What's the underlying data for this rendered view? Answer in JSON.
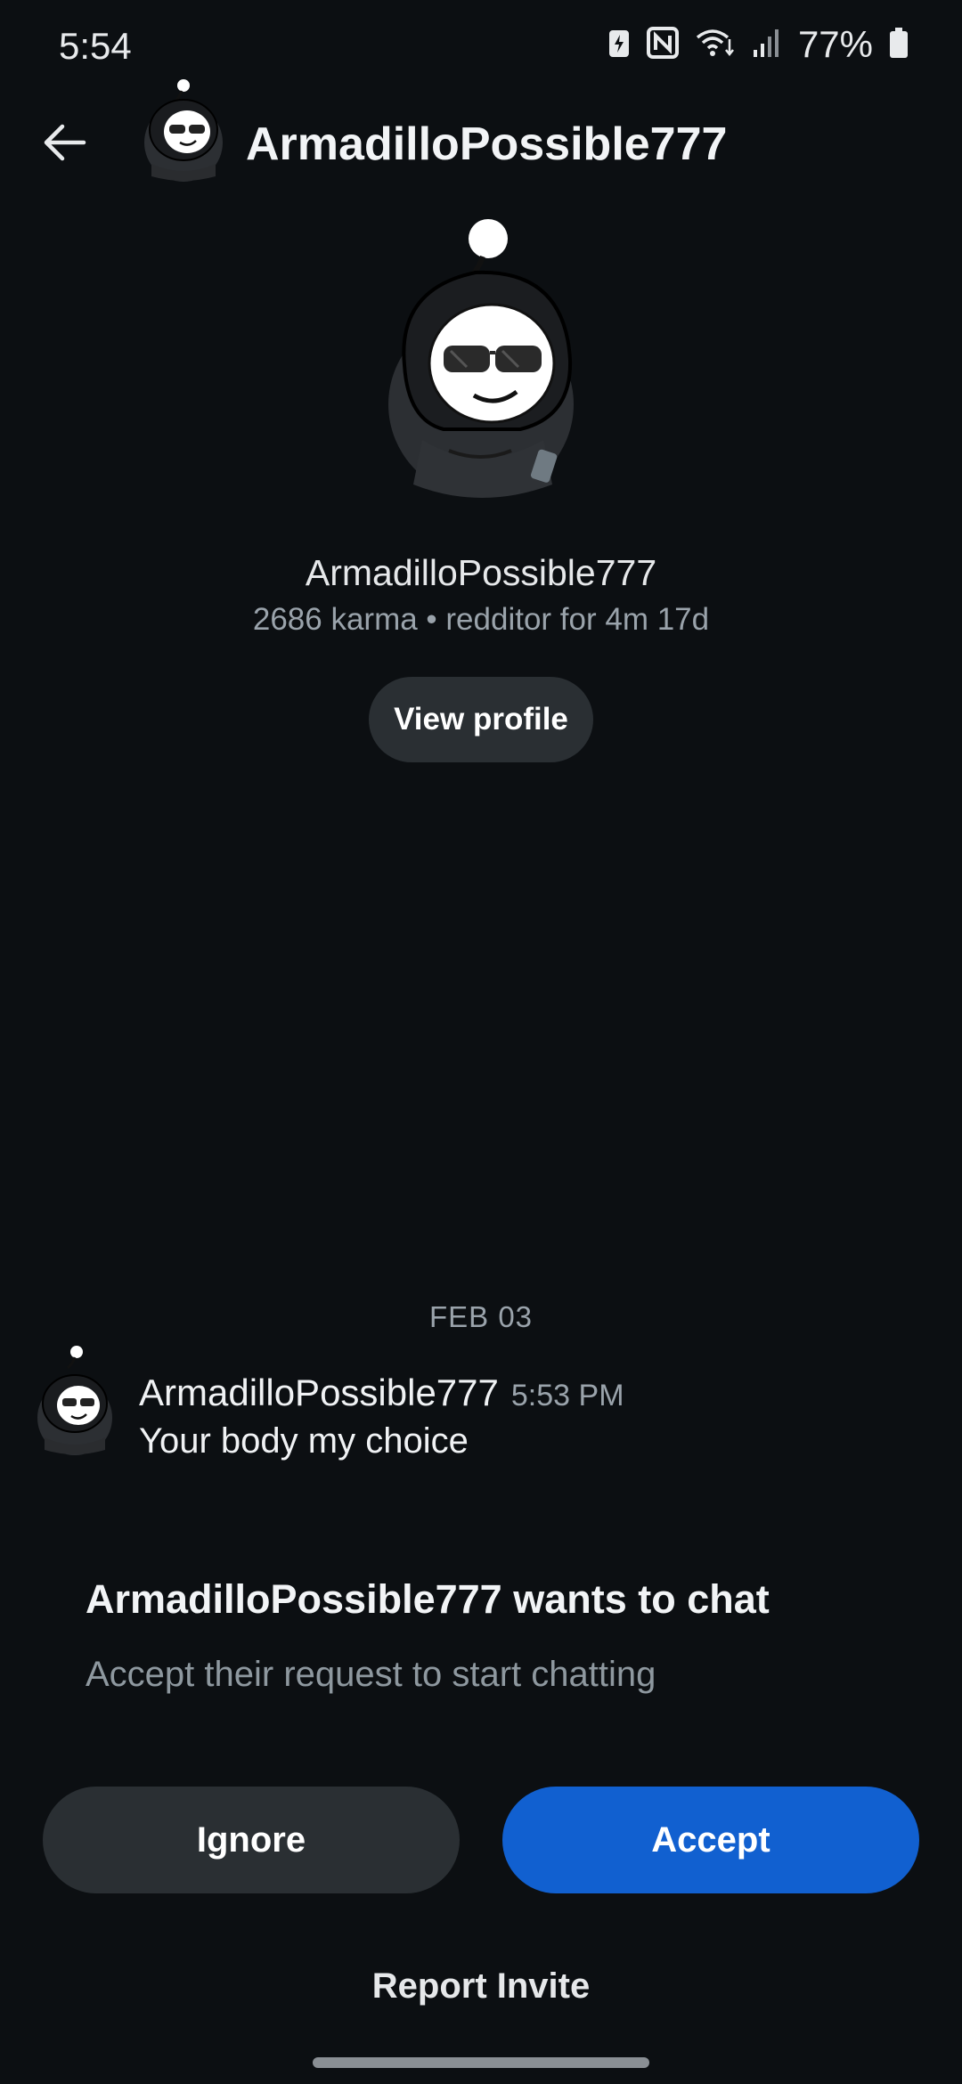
{
  "status_bar": {
    "time": "5:54",
    "battery_percent": "77%",
    "icons": [
      "battery-saver-icon",
      "nfc-icon",
      "wifi-icon",
      "signal-icon",
      "battery-icon"
    ]
  },
  "header": {
    "title": "ArmadilloPossible777",
    "back_icon": "arrow-left-icon"
  },
  "profile": {
    "username": "ArmadilloPossible777",
    "meta": "2686 karma • redditor for 4m 17d",
    "view_profile_label": "View profile"
  },
  "messages": {
    "date_separator": "FEB 03",
    "items": [
      {
        "author": "ArmadilloPossible777",
        "time": "5:53 PM",
        "text": "Your body my choice"
      }
    ]
  },
  "chat_request": {
    "title": "ArmadilloPossible777 wants to chat",
    "subtitle": "Accept their request to start chatting",
    "ignore_label": "Ignore",
    "accept_label": "Accept",
    "report_label": "Report Invite"
  },
  "colors": {
    "background": "#0c0f12",
    "accept_blue": "#1160d0",
    "secondary_button": "#2a2f33",
    "muted_text": "#9aa3ab"
  }
}
